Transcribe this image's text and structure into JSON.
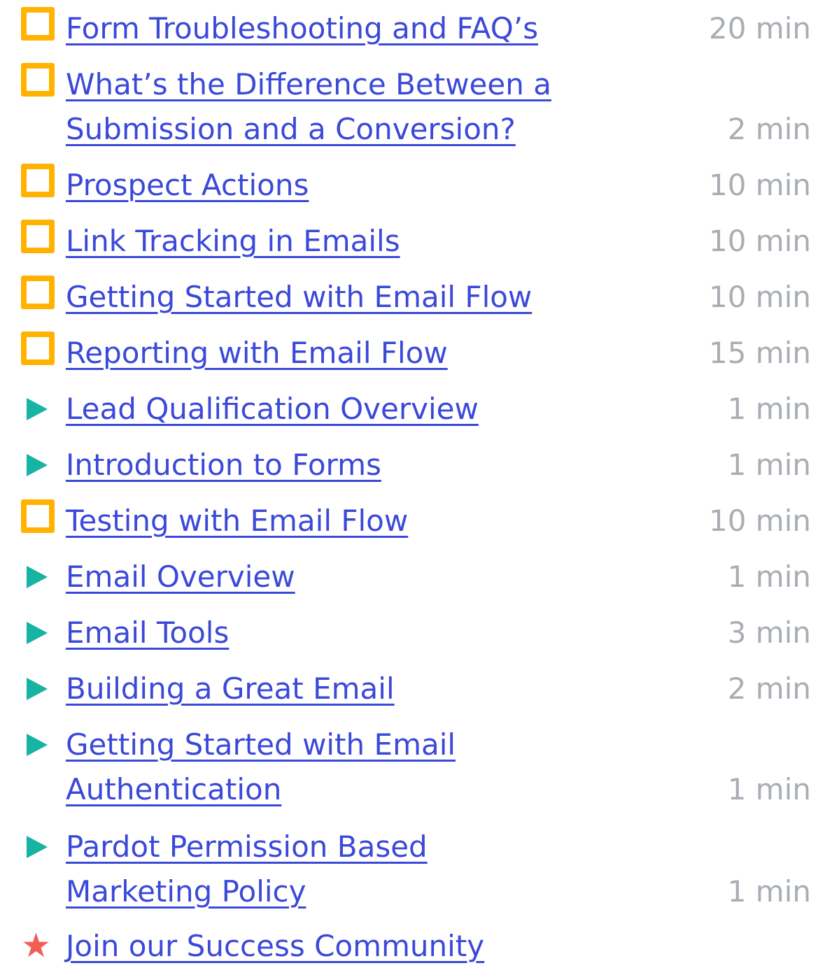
{
  "colors": {
    "link": "#3B49D8",
    "time": "#A9AEB5",
    "project_icon": "#FFB300",
    "module_icon": "#17B3A3",
    "community_icon": "#F25E54"
  },
  "items": [
    {
      "icon": "project-square-icon",
      "title_lines": [
        "Form Troubleshooting and FAQ’s"
      ],
      "time": "20 min"
    },
    {
      "icon": "project-square-icon",
      "title_lines": [
        "What’s the Difference Between a ",
        "Submission and a Conversion?"
      ],
      "time": "2 min"
    },
    {
      "icon": "project-square-icon",
      "title_lines": [
        "Prospect Actions"
      ],
      "time": "10 min"
    },
    {
      "icon": "project-square-icon",
      "title_lines": [
        "Link Tracking in Emails"
      ],
      "time": "10 min"
    },
    {
      "icon": "project-square-icon",
      "title_lines": [
        "Getting Started with Email Flow"
      ],
      "time": "10 min"
    },
    {
      "icon": "project-square-icon",
      "title_lines": [
        "Reporting with Email Flow"
      ],
      "time": "15 min"
    },
    {
      "icon": "play-triangle-icon",
      "title_lines": [
        "Lead Qualification Overview"
      ],
      "time": "1 min"
    },
    {
      "icon": "play-triangle-icon",
      "title_lines": [
        "Introduction to Forms"
      ],
      "time": "1 min"
    },
    {
      "icon": "project-square-icon",
      "title_lines": [
        "Testing with Email Flow"
      ],
      "time": "10 min"
    },
    {
      "icon": "play-triangle-icon",
      "title_lines": [
        "Email Overview"
      ],
      "time": "1 min"
    },
    {
      "icon": "play-triangle-icon",
      "title_lines": [
        "Email Tools"
      ],
      "time": "3 min"
    },
    {
      "icon": "play-triangle-icon",
      "title_lines": [
        "Building a Great Email"
      ],
      "time": "2 min"
    },
    {
      "icon": "play-triangle-icon",
      "title_lines": [
        "Getting Started with Email ",
        "Authentication"
      ],
      "time": "1 min"
    },
    {
      "icon": "play-triangle-icon",
      "title_lines": [
        "Pardot Permission Based ",
        "Marketing Policy"
      ],
      "time": "1 min"
    },
    {
      "icon": "star-icon",
      "title_lines": [
        "Join our Success Community"
      ],
      "time": ""
    }
  ]
}
